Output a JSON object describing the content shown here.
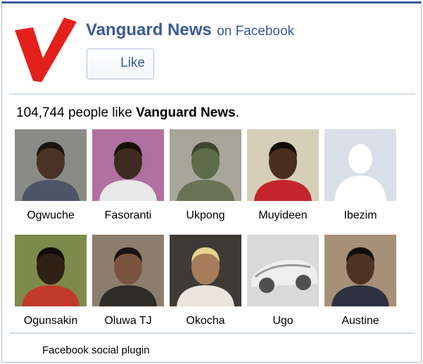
{
  "page": {
    "name": "Vanguard News",
    "on_facebook": "on Facebook",
    "like_label": "Like"
  },
  "likes": {
    "count": "104,744",
    "text": "people like",
    "page_name": "Vanguard News",
    "period": "."
  },
  "fans": [
    {
      "name": "Ogwuche",
      "bg": "#8a8a86",
      "skin": "#4a3326",
      "shirt": "#4d5566",
      "hair": "#1a120d"
    },
    {
      "name": "Fasoranti",
      "bg": "#b070a0",
      "skin": "#3d2a20",
      "shirt": "#e8e8e8",
      "hair": "#14100c"
    },
    {
      "name": "Ukpong",
      "bg": "#a8a69a",
      "skin": "#5d6b4a",
      "shirt": "#6a7256",
      "hair": "#3e4632"
    },
    {
      "name": "Muyideen",
      "bg": "#d6cfb8",
      "skin": "#4a2e1f",
      "shirt": "#c4262e",
      "hair": "#120c08"
    },
    {
      "name": "Ibezim",
      "bg": "#d8dfe9",
      "skin": "#ffffff",
      "shirt": "#ffffff",
      "hair": "#ffffff"
    },
    {
      "name": "Ogunsakin",
      "bg": "#7d8a4c",
      "skin": "#2f2016",
      "shirt": "#c23a2a",
      "hair": "#100c09"
    },
    {
      "name": "Oluwa TJ",
      "bg": "#8b7e6d",
      "skin": "#7a5440",
      "shirt": "#2e2a28",
      "hair": "#1a130f"
    },
    {
      "name": "Okocha",
      "bg": "#3e3a36",
      "skin": "#a67c5a",
      "shirt": "#e9e4dc",
      "hair": "#e6d78a"
    },
    {
      "name": "Ugo",
      "bg": "#d9d9d9",
      "skin": "#9aa0a6",
      "shirt": "#e8e8e8",
      "hair": "#505050"
    },
    {
      "name": "Austine",
      "bg": "#a69078",
      "skin": "#4d3324",
      "shirt": "#2e3140",
      "hair": "#140e0a"
    }
  ],
  "footer": {
    "plugin_text": "Facebook social plugin"
  },
  "colors": {
    "brand": "#3b5998",
    "logo_red": "#e3201b"
  },
  "icons": {
    "logo": "vanguard-v-logo",
    "default_avatar": "silhouette-avatar-icon"
  }
}
